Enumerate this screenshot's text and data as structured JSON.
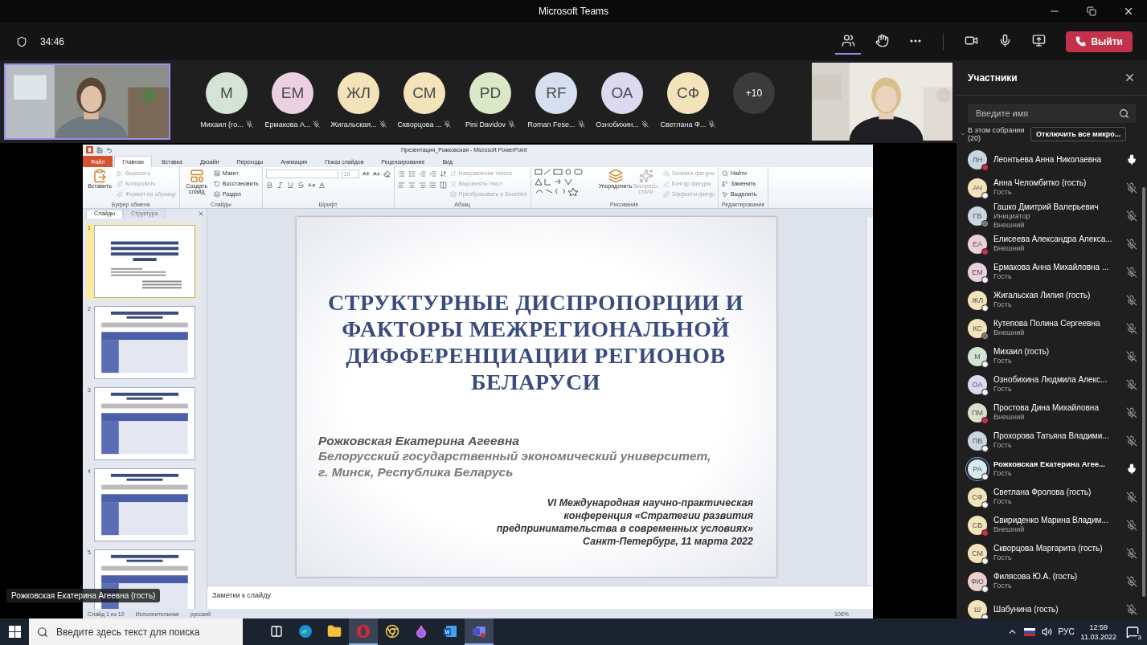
{
  "window": {
    "title": "Microsoft Teams"
  },
  "meeting": {
    "timer": "34:46",
    "leave_button": "Выйти"
  },
  "toolbar": [
    {
      "kind": "participants",
      "selected": true
    },
    {
      "kind": "reactions",
      "selected": false
    },
    {
      "kind": "more",
      "selected": false
    },
    {
      "kind": "camera",
      "selected": false
    },
    {
      "kind": "mic",
      "selected": false
    },
    {
      "kind": "share",
      "selected": false
    }
  ],
  "strip": {
    "tiles": [
      {
        "initials": "M",
        "label": "Михаил (го...",
        "color": "#d3e4d4"
      },
      {
        "initials": "ЕМ",
        "label": "Ермакова А...",
        "color": "#ecd0e2"
      },
      {
        "initials": "ЖЛ",
        "label": "Жигальская...",
        "color": "#f2e3bb"
      },
      {
        "initials": "СМ",
        "label": "Скворцова ...",
        "color": "#f2e3bb"
      },
      {
        "initials": "PD",
        "label": "Pini Davidov",
        "color": "#dbe8c8"
      },
      {
        "initials": "RF",
        "label": "Roman Fese...",
        "color": "#d6dff0"
      },
      {
        "initials": "ОА",
        "label": "Ознобихин...",
        "color": "#dcd8f0"
      },
      {
        "initials": "СФ",
        "label": "Светлана Ф...",
        "color": "#f2e3bb"
      }
    ],
    "overflow": "+10"
  },
  "presenter_label": "Рожковская Екатерина Агеевна (гость)",
  "powerpoint": {
    "title": "Презентация_Рожковская - Microsoft PowerPoint",
    "tabs": [
      {
        "label": "Файл",
        "kind": "file",
        "selected": false
      },
      {
        "label": "Главная",
        "kind": "tab",
        "selected": true
      },
      {
        "label": "Вставка",
        "kind": "tab",
        "selected": false
      },
      {
        "label": "Дизайн",
        "kind": "tab",
        "selected": false
      },
      {
        "label": "Переходы",
        "kind": "tab",
        "selected": false
      },
      {
        "label": "Анимация",
        "kind": "tab",
        "selected": false
      },
      {
        "label": "Показ слайдов",
        "kind": "tab",
        "selected": false
      },
      {
        "label": "Рецензирование",
        "kind": "tab",
        "selected": false
      },
      {
        "label": "Вид",
        "kind": "tab",
        "selected": false
      }
    ],
    "groups": [
      {
        "label": "Буфер обмена",
        "kind": "plain",
        "items": [
          {
            "label": "Вставить",
            "kind": "large",
            "disabled": false
          },
          {
            "label": "Вырезать",
            "kind": "small",
            "disabled": true
          },
          {
            "label": "Копировать",
            "kind": "small",
            "disabled": true
          },
          {
            "label": "Формат по образцу",
            "kind": "small",
            "disabled": true
          }
        ]
      },
      {
        "label": "Слайды",
        "kind": "plain",
        "items": [
          {
            "label": "Создать слайд",
            "kind": "large",
            "disabled": false
          },
          {
            "label": "Макет",
            "kind": "small",
            "disabled": false
          },
          {
            "label": "Восстановить",
            "kind": "small",
            "disabled": false
          },
          {
            "label": "Раздел",
            "kind": "small",
            "disabled": false
          }
        ]
      },
      {
        "label": "Шрифт",
        "kind": "font",
        "font_size": "19"
      },
      {
        "label": "Абзац",
        "kind": "paragraph",
        "items": [
          {
            "label": "Направление текста",
            "kind": "small",
            "disabled": true
          },
          {
            "label": "Выровнять текст",
            "kind": "small",
            "disabled": true
          },
          {
            "label": "Преобразовать в SmartArt",
            "kind": "small",
            "disabled": true
          }
        ]
      },
      {
        "label": "Рисование",
        "kind": "drawing",
        "items": [
          {
            "label": "Упорядочить",
            "kind": "large",
            "disabled": false
          },
          {
            "label": "Экспресс-стили",
            "kind": "large",
            "disabled": true
          },
          {
            "label": "Заливка фигуры",
            "kind": "small",
            "disabled": true
          },
          {
            "label": "Контур фигуры",
            "kind": "small",
            "disabled": true
          },
          {
            "label": "Эффекты фигур",
            "kind": "small",
            "disabled": true
          }
        ]
      },
      {
        "label": "Редактирование",
        "kind": "plain",
        "items": [
          {
            "label": "Найти",
            "kind": "small",
            "disabled": false
          },
          {
            "label": "Заменить",
            "kind": "small",
            "disabled": false
          },
          {
            "label": "Выделить",
            "kind": "small",
            "disabled": false
          }
        ]
      }
    ],
    "pane_tabs": [
      {
        "label": "Слайды",
        "selected": true
      },
      {
        "label": "Структура",
        "selected": false
      }
    ],
    "thumbnails": [
      {
        "number": "1",
        "kind": "title",
        "selected": true
      },
      {
        "number": "2",
        "kind": "table",
        "selected": false
      },
      {
        "number": "3",
        "kind": "table",
        "selected": false
      },
      {
        "number": "4",
        "kind": "table",
        "selected": false
      },
      {
        "number": "5",
        "kind": "table",
        "selected": false
      }
    ],
    "slide": {
      "title_lines": [
        "СТРУКТУРНЫЕ ДИСПРОПОРЦИИ И",
        "ФАКТОРЫ МЕЖРЕГИОНАЛЬНОЙ",
        "ДИФФЕРЕНЦИАЦИИ РЕГИОНОВ",
        "БЕЛАРУСИ"
      ],
      "author": "Рожковская Екатерина Агеевна",
      "affiliation_lines": [
        "Белорусский государственный экономический университет,",
        "г. Минск, Республика Беларусь"
      ],
      "conference_lines": [
        "VI Международная научно-практическая",
        "конференция «Стратегии развития",
        "предпринимательства в современных условиях»",
        "Санкт-Петербург, 11 марта 2022"
      ]
    },
    "notes_placeholder": "Заметки к слайду",
    "status": [
      "Слайд 1 из 10",
      "Исполнительная",
      "русский"
    ],
    "zoom": "106%"
  },
  "participants": {
    "title": "Участники",
    "search": {
      "placeholder": "Введите имя"
    },
    "section": {
      "label": "В этом собрании",
      "count": "(20)",
      "expanded": true
    },
    "mute_all": "Отключить все микро...",
    "people": [
      {
        "initials": "ЛН",
        "name": "Леонтьева Анна Николаевна",
        "color": "#c9d5e0",
        "busy": true,
        "offline": false,
        "mic_on": true,
        "selected": false
      },
      {
        "initials": "АЧ",
        "name": "Анна Челомбитко (гость)",
        "roles": [
          "Гость"
        ],
        "color": "#f2e3bb",
        "busy": false,
        "offline": false,
        "mic_on": false,
        "selected": false
      },
      {
        "initials": "ГВ",
        "name": "Гашко Дмитрий Валерьевич",
        "roles": [
          "Инициатор",
          "Внешний"
        ],
        "color": "#c9d5e0",
        "busy": false,
        "offline": true,
        "mic_on": false,
        "selected": false
      },
      {
        "initials": "ЕА",
        "name": "Елисеева Александра Алекса...",
        "roles": [
          "Внешний"
        ],
        "color": "#ecd0d8",
        "busy": true,
        "offline": false,
        "mic_on": false,
        "selected": false
      },
      {
        "initials": "ЕМ",
        "name": "Ермакова Анна Михайловна ...",
        "roles": [
          "Гость"
        ],
        "color": "#ecd0e2",
        "busy": false,
        "offline": false,
        "mic_on": false,
        "selected": false
      },
      {
        "initials": "ЖЛ",
        "name": "Жигальская Лилия (гость)",
        "roles": [
          "Гость"
        ],
        "color": "#f2e3bb",
        "busy": false,
        "offline": false,
        "mic_on": false,
        "selected": false
      },
      {
        "initials": "КС",
        "name": "Кутепова Полина Сергеевна",
        "roles": [
          "Внешний"
        ],
        "color": "#f2e3bb",
        "busy": false,
        "offline": true,
        "mic_on": false,
        "selected": false
      },
      {
        "initials": "М",
        "name": "Михаил (гость)",
        "roles": [
          "Гость"
        ],
        "color": "#d3e4d4",
        "busy": false,
        "offline": false,
        "mic_on": false,
        "selected": false
      },
      {
        "initials": "ОА",
        "name": "Ознобихина Людмила Алекс...",
        "roles": [
          "Гость"
        ],
        "color": "#dcd8f0",
        "busy": false,
        "offline": false,
        "mic_on": false,
        "selected": false
      },
      {
        "initials": "ПМ",
        "name": "Простова Дина Михайловна",
        "roles": [
          "Внешний"
        ],
        "color": "#dcdfcc",
        "busy": true,
        "offline": false,
        "mic_on": false,
        "selected": false
      },
      {
        "initials": "ПВ",
        "name": "Прохорова Татьяна Владими...",
        "roles": [
          "Гость"
        ],
        "color": "#c9d5e0",
        "busy": false,
        "offline": false,
        "mic_on": false,
        "selected": false
      },
      {
        "initials": "РА",
        "name": "Рожковская Екатерина Агее...",
        "roles": [
          "Гость"
        ],
        "color": "#d5ecef",
        "busy": false,
        "offline": false,
        "mic_on": true,
        "selected": true
      },
      {
        "initials": "СФ",
        "name": "Светлана Фролова (гость)",
        "roles": [
          "Гость"
        ],
        "color": "#f2e3bb",
        "busy": false,
        "offline": false,
        "mic_on": false,
        "selected": false
      },
      {
        "initials": "СВ",
        "name": "Свириденко Марина Владим...",
        "roles": [
          "Внешний"
        ],
        "color": "#f2e3bb",
        "busy": true,
        "offline": false,
        "mic_on": false,
        "selected": false
      },
      {
        "initials": "СМ",
        "name": "Скворцова Маргарита (гость)",
        "roles": [
          "Гость"
        ],
        "color": "#f2e3bb",
        "busy": false,
        "offline": false,
        "mic_on": false,
        "selected": false
      },
      {
        "initials": "ФЮ",
        "name": "Филясова Ю.А. (гость)",
        "roles": [
          "Гость"
        ],
        "color": "#ecd0d0",
        "busy": false,
        "offline": false,
        "mic_on": false,
        "selected": false
      },
      {
        "initials": "Ш",
        "name": "Шабунина (гость)",
        "color": "#f2e3bb",
        "busy": false,
        "offline": false,
        "mic_on": false,
        "selected": false
      }
    ]
  },
  "taskbar": {
    "search_placeholder": "Введите здесь текст для поиска",
    "apps": [
      {
        "kind": "taskview",
        "active": false
      },
      {
        "kind": "edge",
        "active": false
      },
      {
        "kind": "explorer",
        "active": false
      },
      {
        "kind": "opera",
        "active": true
      },
      {
        "kind": "chrome",
        "active": false
      },
      {
        "kind": "droplet",
        "active": false
      },
      {
        "kind": "word",
        "active": false
      },
      {
        "kind": "teams",
        "active": true
      }
    ],
    "language": "РУС",
    "time": "12:59",
    "date": "11.03.2022",
    "notifications": "3"
  }
}
